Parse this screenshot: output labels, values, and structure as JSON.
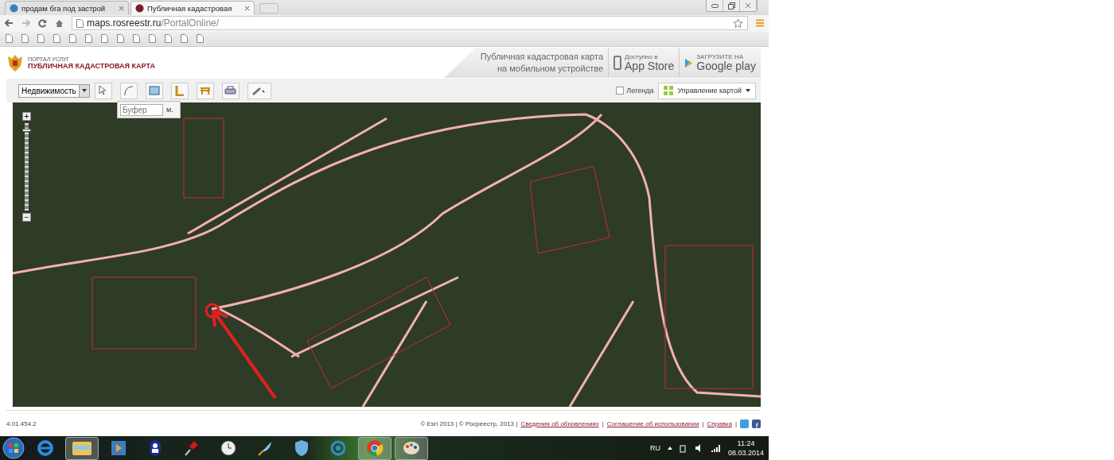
{
  "browser": {
    "tabs": [
      {
        "title": "продам бга под застрой",
        "selected": false
      },
      {
        "title": "Публичная кадастровая",
        "selected": true
      }
    ],
    "address": {
      "host": "maps.rosreestr.ru",
      "path": "/PortalOnline/"
    },
    "bookmarks": [
      {
        "kind": "page"
      },
      {
        "kind": "page"
      },
      {
        "kind": "page"
      },
      {
        "kind": "page"
      },
      {
        "kind": "page"
      },
      {
        "kind": "page"
      },
      {
        "kind": "page"
      },
      {
        "kind": "page"
      },
      {
        "kind": "page"
      },
      {
        "kind": "page"
      },
      {
        "kind": "page"
      },
      {
        "kind": "page"
      },
      {
        "kind": "page"
      }
    ]
  },
  "header": {
    "portal": "ПОРТАЛ УСЛУГ",
    "title": "ПУБЛИЧНАЯ КАДАСТРОВАЯ КАРТА",
    "mobile_text": [
      "Публичная кадастровая карта",
      "на мобильном устройстве"
    ],
    "app_store": {
      "small": "Доступно в",
      "big": "App Store"
    },
    "google_play": {
      "small": "ЗАГРУЗИТЕ НА",
      "big": "Google play"
    }
  },
  "toolbar": {
    "layer_select": "Недвижимость",
    "buffer": {
      "placeholder": "Буфер",
      "unit": "м."
    },
    "legend": {
      "label": "Легенда",
      "checked": false
    },
    "map_control": "Управление картой"
  },
  "map": {
    "zoom_in": "+",
    "zoom_out": "−",
    "zoom_slider": {
      "level": 0.93
    }
  },
  "footer": {
    "version": "4.01.454.2",
    "credits": "© Esri 2013 | © Росреестр, 2013 |",
    "links": [
      {
        "text": "Сведения об обновлениях"
      },
      {
        "text": "Соглашение об использовании"
      },
      {
        "text": "Справка"
      }
    ],
    "separator": "|"
  },
  "taskbar": {
    "apps": [
      {
        "kind": "ie",
        "active": false
      },
      {
        "kind": "explorer",
        "active": true
      },
      {
        "kind": "media",
        "active": false
      },
      {
        "kind": "contacts",
        "active": false
      },
      {
        "kind": "pin",
        "active": false
      },
      {
        "kind": "clock",
        "active": false
      },
      {
        "kind": "feather",
        "active": false
      },
      {
        "kind": "shield",
        "active": false
      },
      {
        "kind": "ring",
        "active": false
      },
      {
        "kind": "chrome",
        "active": true
      },
      {
        "kind": "paint",
        "active": true
      }
    ],
    "language": "RU",
    "time": "11:24",
    "date": "08.03.2014"
  }
}
